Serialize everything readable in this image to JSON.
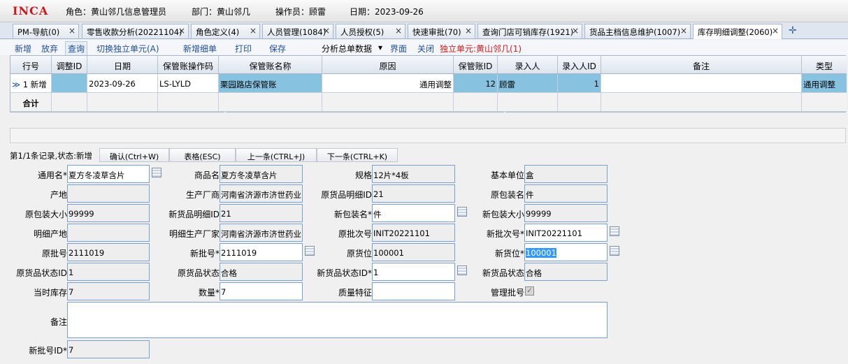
{
  "header": {
    "logo": "INCA",
    "role": "角色：黄山邻几信息管理员",
    "dept": "部门：黄山邻几",
    "operator": "操作员：顾雷",
    "date": "日期：2023-09-26"
  },
  "tabs": [
    {
      "label": "PM-导航(0)"
    },
    {
      "label": "零售收款分析(20221104)"
    },
    {
      "label": "角色定义(4)"
    },
    {
      "label": "人员管理(1084)"
    },
    {
      "label": "人员授权(5)"
    },
    {
      "label": "快速审批(70)"
    },
    {
      "label": "查询门店可销库存(1921)"
    },
    {
      "label": "货品主档信息维护(1007)"
    },
    {
      "label": "库存明细调整(2060)"
    }
  ],
  "tab_close": "×",
  "tab_add": "✛",
  "toolbar": {
    "new": "新增",
    "discard": "放弃",
    "query": "查询",
    "switch": "切换独立单元(A)",
    "add_detail": "新增细单",
    "print": "打印",
    "save": "保存",
    "analysis": "分析总单数据",
    "arrow": "▾",
    "ui": "界面",
    "close": "关闭",
    "unit": "独立单元:黄山邻几(1)"
  },
  "grid": {
    "headers": [
      "行号",
      "调整ID",
      "日期",
      "保管账操作码",
      "保管账名称",
      "原因",
      "保管账ID",
      "录入人",
      "录入人ID",
      "备注",
      "类型"
    ],
    "row": {
      "indicator": "≫",
      "rownum": "1 新增",
      "adjust_id": "",
      "date": "2023-09-26",
      "code": "LS-LYLD",
      "name": "栗园路店保管账",
      "reason": "通用调整",
      "acct_id": "12",
      "entered_by": "顾雷",
      "entered_by_id": "1",
      "remark": "",
      "type": "通用调整"
    },
    "total_label": "合计"
  },
  "status": {
    "text": "第1/1条记录,状态:新增",
    "confirm": "确认(Ctrl+W)",
    "table": "表格(ESC)",
    "prev": "上一条(CTRL+J)",
    "next": "下一条(CTRL+K)"
  },
  "form": {
    "generic_name_label": "通用名*",
    "generic_name": "夏方冬凌草含片",
    "product_name_label": "商品名",
    "product_name": "夏方冬凌草含片",
    "spec_label": "规格",
    "spec": "12片*4板",
    "base_unit_label": "基本单位",
    "base_unit": "盒",
    "origin_label": "产地",
    "origin": "",
    "maker_label": "生产厂商",
    "maker": "河南省济源市济世药业",
    "orig_detail_id_label": "原货品明细ID",
    "orig_detail_id": "21",
    "orig_pack_label": "原包装名",
    "orig_pack": "件",
    "orig_pack_size_label": "原包装大小",
    "orig_pack_size": "99999",
    "new_detail_id_label": "新货品明细ID",
    "new_detail_id": "21",
    "new_pack_label": "新包装名*",
    "new_pack": "件",
    "new_pack_size_label": "新包装大小",
    "new_pack_size": "99999",
    "detail_origin_label": "明细产地",
    "detail_origin": "",
    "detail_maker_label": "明细生产厂家",
    "detail_maker": "河南省济源市济世药业",
    "orig_lot_label": "原批次号",
    "orig_lot": "INIT20221101",
    "new_lot_label": "新批次号*",
    "new_lot": "INIT20221101",
    "orig_batch_label": "原批号",
    "orig_batch": "2111019",
    "new_batch_label": "新批号*",
    "new_batch": "2111019",
    "orig_loc_label": "原货位",
    "orig_loc": "100001",
    "new_loc_label": "新货位*",
    "new_loc": "100001",
    "orig_status_id_label": "原货品状态ID",
    "orig_status_id": "1",
    "orig_status_label": "原货品状态",
    "orig_status": "合格",
    "new_status_id_label": "新货品状态ID*",
    "new_status_id": "1",
    "new_status_label": "新货品状态",
    "new_status": "合格",
    "stock_label": "当时库存",
    "stock": "7",
    "qty_label": "数量*",
    "qty": "7",
    "quality_label": "质量特征",
    "quality": "",
    "manage_batch_label": "管理批号",
    "manage_batch_check": "✓",
    "remark_label": "备注",
    "remark": "",
    "new_batch_id_label": "新批号ID*",
    "new_batch_id": "7"
  },
  "colors": {
    "row_blue": "#87c3e0",
    "field_border": "#7aa0d0",
    "logo_red": "#cc1a1a"
  }
}
